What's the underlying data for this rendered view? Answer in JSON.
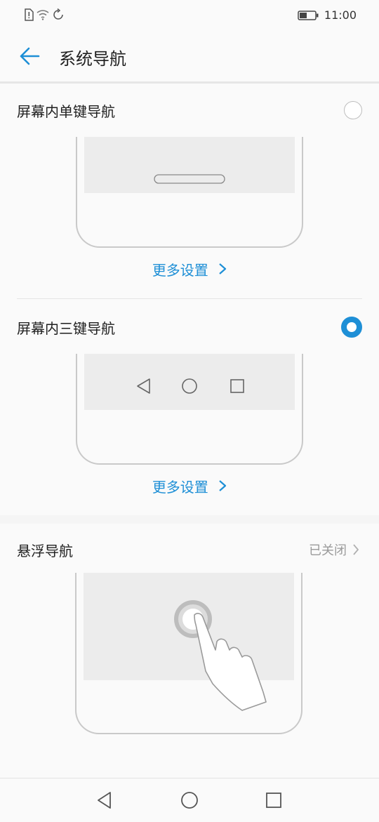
{
  "status_bar": {
    "time": "11:00"
  },
  "header": {
    "title": "系统导航"
  },
  "options": [
    {
      "label": "屏幕内单键导航",
      "selected": false,
      "more_settings": "更多设置"
    },
    {
      "label": "屏幕内三键导航",
      "selected": true,
      "more_settings": "更多设置"
    }
  ],
  "floating_nav": {
    "label": "悬浮导航",
    "status": "已关闭"
  },
  "icons": {
    "back": "arrow-left-icon",
    "chevron": "chevron-right-icon",
    "nav_back": "triangle-back-icon",
    "nav_home": "circle-home-icon",
    "nav_recent": "square-recent-icon"
  },
  "colors": {
    "accent": "#1e8fd6",
    "background": "#fafafa",
    "section_gap": "#f0f0f0"
  }
}
